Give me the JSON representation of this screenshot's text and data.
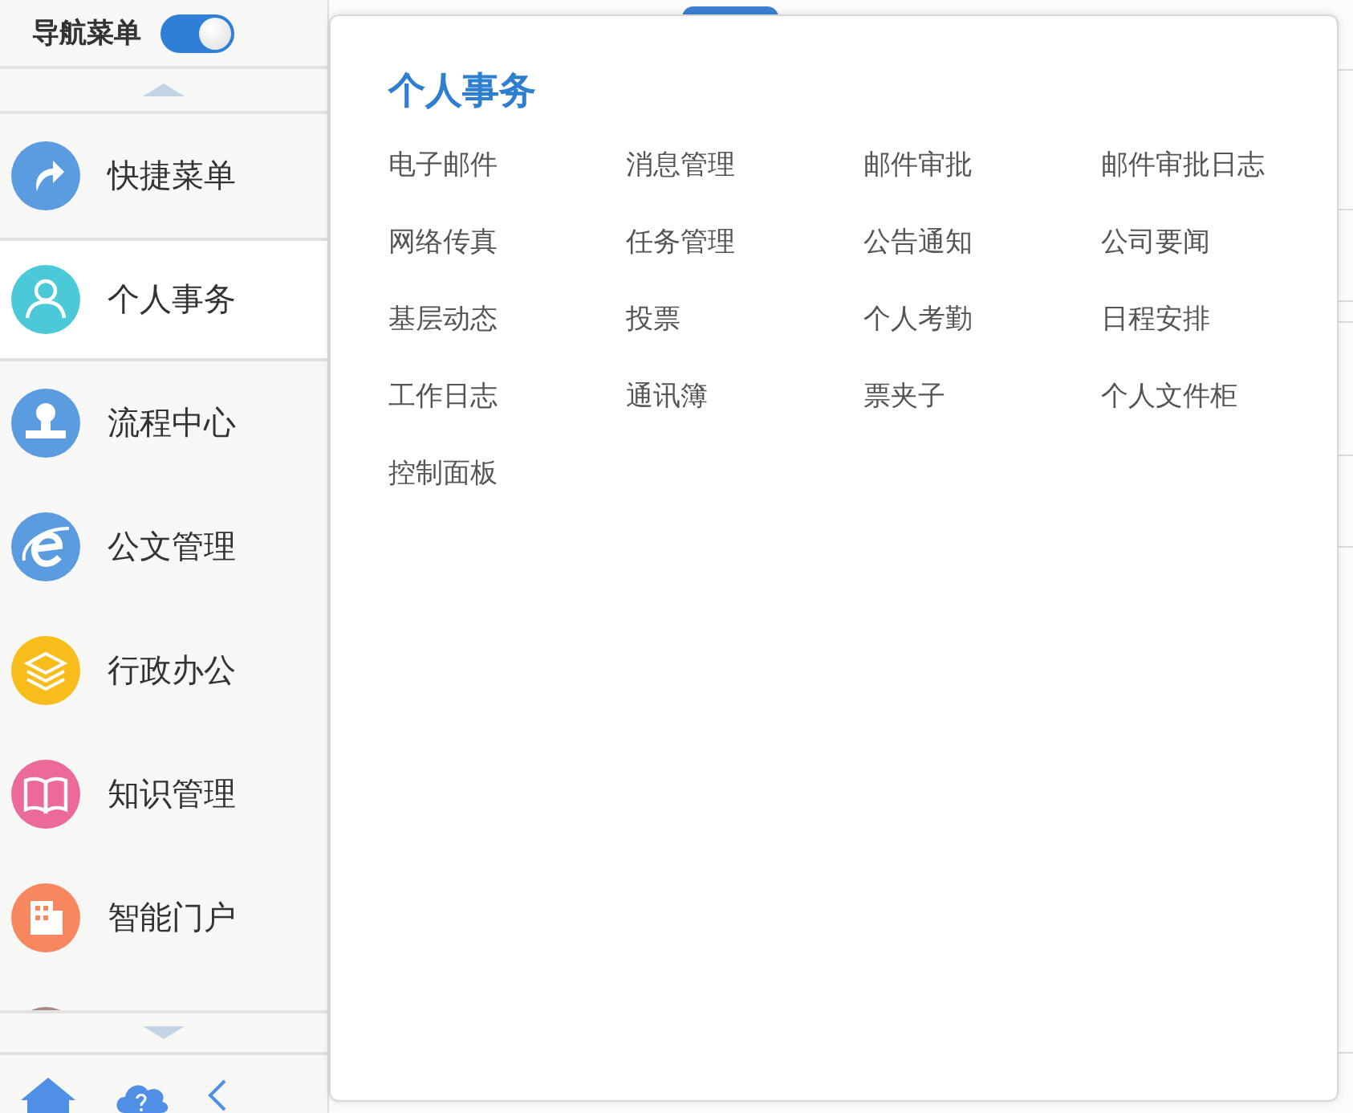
{
  "nav_header": {
    "label": "导航菜单",
    "toggle_on": true
  },
  "sidebar": {
    "items": [
      {
        "label": "快捷菜单",
        "kind": "share",
        "color": "#5b9be0",
        "selected": false
      },
      {
        "label": "个人事务",
        "kind": "person",
        "color": "#4cc9d9",
        "selected": true
      },
      {
        "label": "流程中心",
        "kind": "stamp",
        "color": "#5b9be0",
        "selected": false
      },
      {
        "label": "公文管理",
        "kind": "browser",
        "color": "#5b9be0",
        "selected": false
      },
      {
        "label": "行政办公",
        "kind": "layers",
        "color": "#f8bd1a",
        "selected": false
      },
      {
        "label": "知识管理",
        "kind": "book",
        "color": "#ec6a9a",
        "selected": false
      },
      {
        "label": "智能门户",
        "kind": "building",
        "color": "#f7875e",
        "selected": false
      },
      {
        "kind": "blank",
        "color": "#a88a80",
        "selected": false
      }
    ]
  },
  "popup": {
    "title": "个人事务",
    "links": [
      "电子邮件",
      "消息管理",
      "邮件审批",
      "邮件审批日志",
      "网络传真",
      "任务管理",
      "公告通知",
      "公司要闻",
      "基层动态",
      "投票",
      "个人考勤",
      "日程安排",
      "工作日志",
      "通讯簿",
      "票夹子",
      "个人文件柜",
      "控制面板"
    ]
  }
}
